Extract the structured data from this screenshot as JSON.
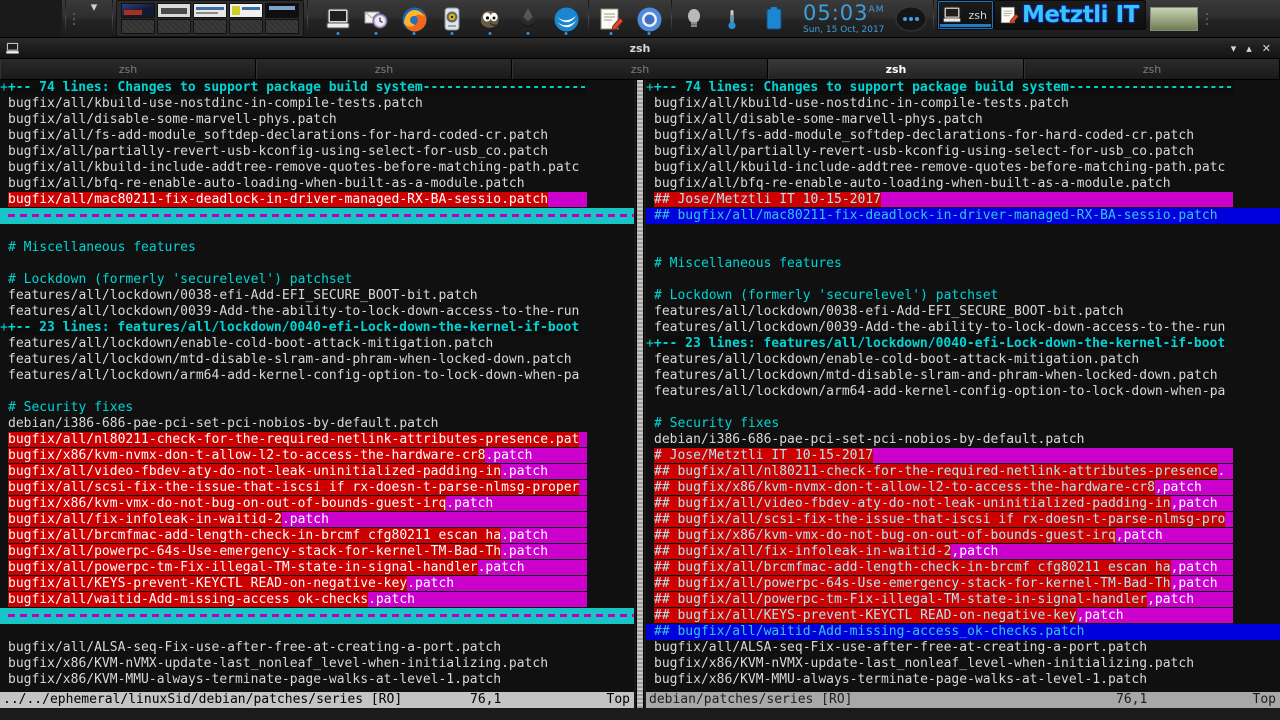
{
  "taskbar": {
    "chevron": "▾",
    "pager_label": "workspace-pager",
    "launchers": [
      {
        "name": "terminal-icon",
        "label": "Terminal"
      },
      {
        "name": "clock-mail-icon",
        "label": "Mail"
      },
      {
        "name": "firefox-icon",
        "label": "Firefox"
      },
      {
        "name": "audio-icon",
        "label": "Audio Mixer"
      },
      {
        "name": "gimp-icon",
        "label": "GIMP"
      },
      {
        "name": "inkscape-icon",
        "label": "Inkscape"
      },
      {
        "name": "libreoffice-icon",
        "label": "LibreOffice"
      },
      {
        "name": "text-editor-icon",
        "label": "Text Editor"
      },
      {
        "name": "chromium-icon",
        "label": "Chromium"
      }
    ],
    "tray": [
      {
        "name": "lightbulb-icon",
        "label": "Brightness"
      },
      {
        "name": "thermometer-icon",
        "label": "Temperature"
      },
      {
        "name": "battery-icon",
        "label": "Battery"
      }
    ],
    "clock": {
      "time": "05:03",
      "meridiem": "AM",
      "date": "Sun, 15 Oct, 2017"
    },
    "windows": [
      {
        "name": "taskbar-window-zsh",
        "label": "zsh",
        "active": true
      },
      {
        "name": "taskbar-window-metztli",
        "label": "Metztli IT",
        "active": false
      }
    ]
  },
  "window": {
    "title": "zsh",
    "icon": "terminal-icon",
    "buttons": {
      "minimize": "▾",
      "maximize": "▴",
      "close": "✕"
    },
    "tabs": [
      {
        "label": "zsh",
        "active": false
      },
      {
        "label": "zsh",
        "active": false
      },
      {
        "label": "zsh",
        "active": false
      },
      {
        "label": "zsh",
        "active": true
      },
      {
        "label": "zsh",
        "active": false
      }
    ]
  },
  "colors": {
    "diff_change_bg": "#cc0000",
    "diff_fill_bg": "#cc00cc",
    "cursor_line_bg": "#0000dd",
    "fold_fg": "#00d5d5",
    "separator_bg": "#17c5c5",
    "accent_blue": "#1e7bc8"
  },
  "left_pane": {
    "status": {
      "file": "../../ephemeral/linuxSid/debian/patches/series [RO]",
      "position": "76,1",
      "scroll": "Top",
      "active": true
    },
    "lines": [
      {
        "kind": "fold",
        "sign": "+",
        "text": "+-- 74 lines: Changes to support package build system---------------------"
      },
      {
        "kind": "plain",
        "text": "bugfix/all/kbuild-use-nostdinc-in-compile-tests.patch"
      },
      {
        "kind": "plain",
        "text": "bugfix/all/disable-some-marvell-phys.patch"
      },
      {
        "kind": "plain",
        "text": "bugfix/all/fs-add-module_softdep-declarations-for-hard-coded-cr.patch"
      },
      {
        "kind": "plain",
        "text": "bugfix/all/partially-revert-usb-kconfig-using-select-for-usb_co.patch"
      },
      {
        "kind": "plain",
        "text": "bugfix/all/kbuild-include-addtree-remove-quotes-before-matching-path.patc"
      },
      {
        "kind": "plain",
        "text": "bugfix/all/bfq-re-enable-auto-loading-when-built-as-a-module.patch"
      },
      {
        "kind": "diff",
        "chg": "bugfix/all/mac80211-fix-deadlock-in-driver-managed-RX-BA-sessio.patch",
        "fill": "",
        "cursor": true
      },
      {
        "kind": "sep"
      },
      {
        "kind": "blank"
      },
      {
        "kind": "comment",
        "text": "# Miscellaneous features"
      },
      {
        "kind": "blank"
      },
      {
        "kind": "comment",
        "text": "# Lockdown (formerly 'securelevel') patchset"
      },
      {
        "kind": "plain",
        "text": "features/all/lockdown/0038-efi-Add-EFI_SECURE_BOOT-bit.patch"
      },
      {
        "kind": "plain",
        "text": "features/all/lockdown/0039-Add-the-ability-to-lock-down-access-to-the-run"
      },
      {
        "kind": "fold",
        "sign": "+",
        "text": "+-- 23 lines: features/all/lockdown/0040-efi-Lock-down-the-kernel-if-boot"
      },
      {
        "kind": "plain",
        "text": "features/all/lockdown/enable-cold-boot-attack-mitigation.patch"
      },
      {
        "kind": "plain",
        "text": "features/all/lockdown/mtd-disable-slram-and-phram-when-locked-down.patch"
      },
      {
        "kind": "plain",
        "text": "features/all/lockdown/arm64-add-kernel-config-option-to-lock-down-when-pa"
      },
      {
        "kind": "blank"
      },
      {
        "kind": "comment",
        "text": "# Security fixes"
      },
      {
        "kind": "plain",
        "text": "debian/i386-686-pae-pci-set-pci-nobios-by-default.patch"
      },
      {
        "kind": "diff",
        "chg": "bugfix/all/nl80211-check-for-the-required-netlink-attributes-presence.pat",
        "fill": ""
      },
      {
        "kind": "diff",
        "chg": "bugfix/x86/kvm-nvmx-don-t-allow-l2-to-access-the-hardware-cr8",
        "fill": ".patch"
      },
      {
        "kind": "diff",
        "chg": "bugfix/all/video-fbdev-aty-do-not-leak-uninitialized-padding-in",
        "fill": ".patch"
      },
      {
        "kind": "diff",
        "chg": "bugfix/all/scsi-fix-the-issue-that-iscsi if rx-doesn-t-parse-nlmsg-proper",
        "fill": ""
      },
      {
        "kind": "diff",
        "chg": "bugfix/x86/kvm-vmx-do-not-bug-on-out-of-bounds-guest-irq",
        "fill": ".patch"
      },
      {
        "kind": "diff",
        "chg": "bugfix/all/fix-infoleak-in-waitid-2",
        "fill": ".patch"
      },
      {
        "kind": "diff",
        "chg": "bugfix/all/brcmfmac-add-length-check-in-brcmf cfg80211 escan ha",
        "fill": ".patch"
      },
      {
        "kind": "diff",
        "chg": "bugfix/all/powerpc-64s-Use-emergency-stack-for-kernel-TM-Bad-Th",
        "fill": ".patch"
      },
      {
        "kind": "diff",
        "chg": "bugfix/all/powerpc-tm-Fix-illegal-TM-state-in-signal-handler",
        "fill": ".patch"
      },
      {
        "kind": "diff",
        "chg": "bugfix/all/KEYS-prevent-KEYCTL READ-on-negative-key",
        "fill": ".patch"
      },
      {
        "kind": "diff",
        "chg": "bugfix/all/waitid-Add-missing-access ok-checks",
        "fill": ".patch"
      },
      {
        "kind": "sep"
      },
      {
        "kind": "blank"
      },
      {
        "kind": "plain",
        "text": "bugfix/all/ALSA-seq-Fix-use-after-free-at-creating-a-port.patch"
      },
      {
        "kind": "plain",
        "text": "bugfix/x86/KVM-nVMX-update-last_nonleaf_level-when-initializing.patch"
      },
      {
        "kind": "plain",
        "text": "bugfix/x86/KVM-MMU-always-terminate-page-walks-at-level-1.patch"
      }
    ]
  },
  "right_pane": {
    "status": {
      "file": "debian/patches/series [RO]",
      "position": "76,1",
      "scroll": "Top",
      "active": false
    },
    "lines": [
      {
        "kind": "fold",
        "sign": "+",
        "text": "+-- 74 lines: Changes to support package build system---------------------"
      },
      {
        "kind": "plain",
        "text": "bugfix/all/kbuild-use-nostdinc-in-compile-tests.patch"
      },
      {
        "kind": "plain",
        "text": "bugfix/all/disable-some-marvell-phys.patch"
      },
      {
        "kind": "plain",
        "text": "bugfix/all/fs-add-module_softdep-declarations-for-hard-coded-cr.patch"
      },
      {
        "kind": "plain",
        "text": "bugfix/all/partially-revert-usb-kconfig-using-select-for-usb_co.patch"
      },
      {
        "kind": "plain",
        "text": "bugfix/all/kbuild-include-addtree-remove-quotes-before-matching-path.patc"
      },
      {
        "kind": "plain",
        "text": "bugfix/all/bfq-re-enable-auto-loading-when-built-as-a-module.patch"
      },
      {
        "kind": "diffadd",
        "chg": "## Jose/Metztli IT 10-15-2017",
        "fill": ""
      },
      {
        "kind": "cursorline",
        "text": "## bugfix/all/mac80211-fix-deadlock-in-driver-managed-RX-BA-sessio.patch"
      },
      {
        "kind": "blank"
      },
      {
        "kind": "blank"
      },
      {
        "kind": "comment",
        "text": "# Miscellaneous features"
      },
      {
        "kind": "blank"
      },
      {
        "kind": "comment",
        "text": "# Lockdown (formerly 'securelevel') patchset"
      },
      {
        "kind": "plain",
        "text": "features/all/lockdown/0038-efi-Add-EFI_SECURE_BOOT-bit.patch"
      },
      {
        "kind": "plain",
        "text": "features/all/lockdown/0039-Add-the-ability-to-lock-down-access-to-the-run"
      },
      {
        "kind": "fold",
        "sign": "+",
        "text": "+-- 23 lines: features/all/lockdown/0040-efi-Lock-down-the-kernel-if-boot"
      },
      {
        "kind": "plain",
        "text": "features/all/lockdown/enable-cold-boot-attack-mitigation.patch"
      },
      {
        "kind": "plain",
        "text": "features/all/lockdown/mtd-disable-slram-and-phram-when-locked-down.patch"
      },
      {
        "kind": "plain",
        "text": "features/all/lockdown/arm64-add-kernel-config-option-to-lock-down-when-pa"
      },
      {
        "kind": "blank"
      },
      {
        "kind": "comment",
        "text": "# Security fixes"
      },
      {
        "kind": "plain",
        "text": "debian/i386-686-pae-pci-set-pci-nobios-by-default.patch"
      },
      {
        "kind": "diffadd",
        "chg": "# Jose/Metztli IT 10-15-2017",
        "fill": ""
      },
      {
        "kind": "diffadd",
        "chg": "## bugfix/all/nl80211-check-for-the-required-netlink-attributes-presence",
        "fill": "."
      },
      {
        "kind": "diffadd",
        "chg": "## bugfix/x86/kvm-nvmx-don-t-allow-l2-to-access-the-hardware-cr8",
        ",fill": "",
        "fill": ",patch"
      },
      {
        "kind": "diffadd",
        "chg": "## bugfix/all/video-fbdev-aty-do-not-leak-uninitialized-padding-in",
        "fill": ",patch"
      },
      {
        "kind": "diffadd",
        "chg": "## bugfix/all/scsi-fix-the-issue-that-iscsi if rx-doesn-t-parse-nlmsg-pro",
        "fill": ""
      },
      {
        "kind": "diffadd",
        "chg": "## bugfix/x86/kvm-vmx-do-not-bug-on-out-of-bounds-guest-irq",
        "fill": ",patch"
      },
      {
        "kind": "diffadd",
        "chg": "## bugfix/all/fix-infoleak-in-waitid-2",
        "fill": ",patch"
      },
      {
        "kind": "diffadd",
        "chg": "## bugfix/all/brcmfmac-add-length-check-in-brcmf cfg80211 escan ha",
        "fill": ",patch"
      },
      {
        "kind": "diffadd",
        "chg": "## bugfix/all/powerpc-64s-Use-emergency-stack-for-kernel-TM-Bad-Th",
        "fill": ",patch"
      },
      {
        "kind": "diffadd",
        "chg": "## bugfix/all/powerpc-tm-Fix-illegal-TM-state-in-signal-handler",
        "fill": ",patch"
      },
      {
        "kind": "diffadd",
        "chg": "## bugfix/all/KEYS-prevent-KEYCTL READ-on-negative-key",
        "fill": ",patch"
      },
      {
        "kind": "cursorline",
        "text": "## bugfix/all/waitid-Add-missing-access_ok-checks.patch"
      },
      {
        "kind": "plain",
        "text": "bugfix/all/ALSA-seq-Fix-use-after-free-at-creating-a-port.patch"
      },
      {
        "kind": "plain",
        "text": "bugfix/x86/KVM-nVMX-update-last_nonleaf_level-when-initializing.patch"
      },
      {
        "kind": "plain",
        "text": "bugfix/x86/KVM-MMU-always-terminate-page-walks-at-level-1.patch"
      }
    ]
  }
}
